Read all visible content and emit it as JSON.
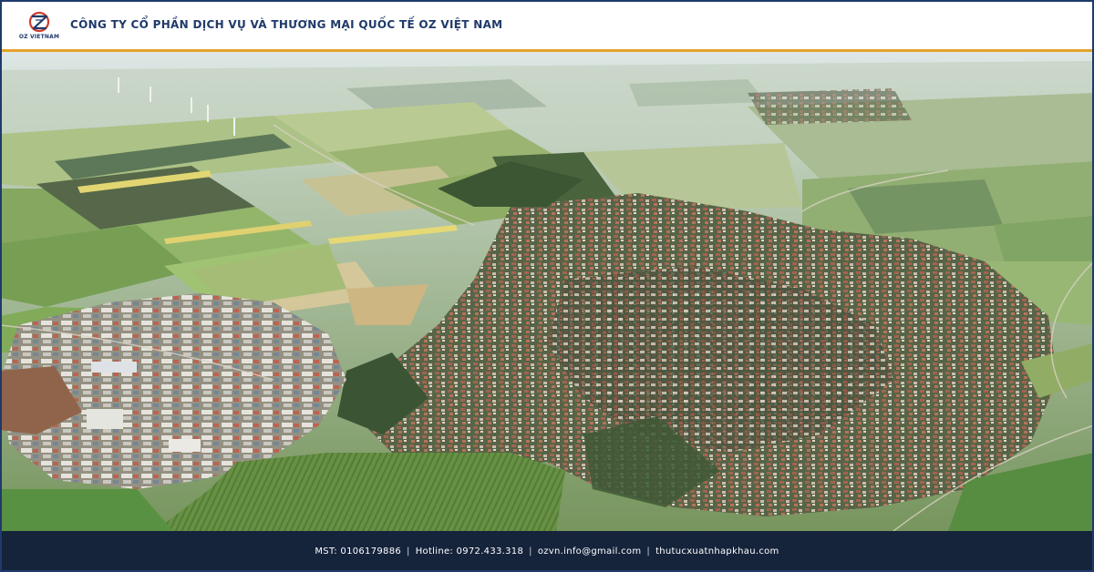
{
  "header": {
    "logo_text": "OZ VIETNAM",
    "company_name": "CÔNG TY CỔ PHẦN DỊCH VỤ VÀ THƯƠNG MẠI QUỐC TẾ OZ VIỆT NAM"
  },
  "photo": {
    "subject": "aerial-town-fields"
  },
  "footer": {
    "tax_code": "MST: 0106179886",
    "hotline": "Hotline: 0972.433.318",
    "email": "ozvn.info@gmail.com",
    "website": "thutucxuatnhapkhau.com",
    "separator": "|"
  },
  "colors": {
    "brand_navy": "#1f3a6b",
    "accent_orange": "#e3a22a",
    "logo_red": "#d23a2a",
    "footer_bg": "#15233b"
  }
}
